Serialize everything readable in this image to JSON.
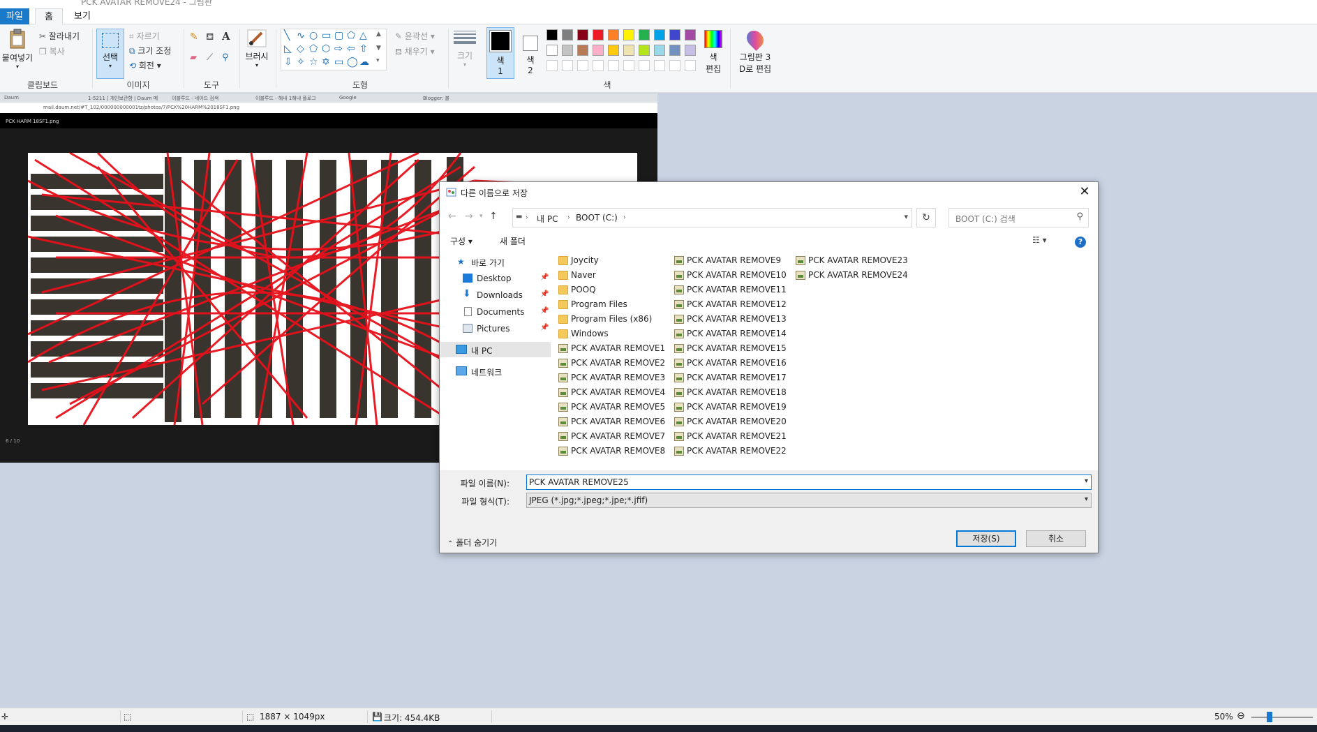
{
  "window": {
    "title": "PCK AVATAR REMOVE24 - 그림판"
  },
  "ribbon": {
    "tabs": {
      "file": "파일",
      "home": "홈",
      "view": "보기"
    },
    "clipboard": {
      "paste": "붙여넣기",
      "cut": "잘라내기",
      "copy": "복사",
      "label": "클립보드"
    },
    "image": {
      "select": "선택",
      "crop": "자르기",
      "resize": "크기 조정",
      "rotate": "회전",
      "label": "이미지"
    },
    "tools": {
      "label": "도구"
    },
    "brushes": {
      "label": "브러시"
    },
    "shapes": {
      "outline": "윤곽선",
      "fill": "채우기",
      "label": "도형"
    },
    "size": {
      "label": "크기"
    },
    "color1": {
      "line1": "색",
      "line2": "1"
    },
    "color2": {
      "line1": "색",
      "line2": "2"
    },
    "edit_colors": {
      "line1": "색",
      "line2": "편집"
    },
    "paint3d": {
      "line1": "그림판 3",
      "line2": "D로 편집"
    },
    "colors_label": "색",
    "palette_row1": [
      "#000000",
      "#7f7f7f",
      "#880015",
      "#ed1c24",
      "#ff7f27",
      "#fff200",
      "#22b14c",
      "#00a2e8",
      "#3f48cc",
      "#a349a4"
    ],
    "palette_row2": [
      "#ffffff",
      "#c3c3c3",
      "#b97a57",
      "#ffaec9",
      "#ffc90e",
      "#efe4b0",
      "#b5e61d",
      "#99d9ea",
      "#7092be",
      "#c8bfe7"
    ]
  },
  "pasted_image": {
    "tabs": [
      "Daum",
      "1-5211 | 개인보관함 | Daum 메",
      "이블루드 - 네이드 검색",
      "이블루드 - 해내 1해내 플로그",
      "Google",
      "Blogger: 블"
    ],
    "url": "mail.daum.net/#T_102/000000000001tz/photos/7/PCK%20HARM%2018SF1.png",
    "viewer_title": "PCK HARM 18SF1.png",
    "page_indicator": "6 / 10"
  },
  "dialog": {
    "title": "다른 이름으로 저장",
    "close": "✕",
    "path": [
      "내 PC",
      "BOOT (C:)"
    ],
    "search_placeholder": "BOOT (C:) 검색",
    "organize": "구성",
    "new_folder": "새 폴더",
    "nav": [
      {
        "label": "바로 가기",
        "pinned": false
      },
      {
        "label": "Desktop",
        "pinned": true
      },
      {
        "label": "Downloads",
        "pinned": true
      },
      {
        "label": "Documents",
        "pinned": true
      },
      {
        "label": "Pictures",
        "pinned": true
      },
      {
        "label": "내 PC",
        "pinned": false
      },
      {
        "label": "네트워크",
        "pinned": false
      }
    ],
    "folders": [
      "Joycity",
      "Naver",
      "POOQ",
      "Program Files",
      "Program Files (x86)",
      "Windows"
    ],
    "files_col1": [
      "PCK AVATAR REMOVE1",
      "PCK AVATAR REMOVE2",
      "PCK AVATAR REMOVE3",
      "PCK AVATAR REMOVE4",
      "PCK AVATAR REMOVE5",
      "PCK AVATAR REMOVE6",
      "PCK AVATAR REMOVE7",
      "PCK AVATAR REMOVE8"
    ],
    "files_col2": [
      "PCK AVATAR REMOVE9",
      "PCK AVATAR REMOVE10",
      "PCK AVATAR REMOVE11",
      "PCK AVATAR REMOVE12",
      "PCK AVATAR REMOVE13",
      "PCK AVATAR REMOVE14",
      "PCK AVATAR REMOVE15",
      "PCK AVATAR REMOVE16",
      "PCK AVATAR REMOVE17",
      "PCK AVATAR REMOVE18",
      "PCK AVATAR REMOVE19",
      "PCK AVATAR REMOVE20",
      "PCK AVATAR REMOVE21",
      "PCK AVATAR REMOVE22"
    ],
    "files_col3": [
      "PCK AVATAR REMOVE23",
      "PCK AVATAR REMOVE24"
    ],
    "filename_label": "파일 이름(N):",
    "filename_value": "PCK AVATAR REMOVE25",
    "filetype_label": "파일 형식(T):",
    "filetype_value": "JPEG (*.jpg;*.jpeg;*.jpe;*.jfif)",
    "hide_folders": "폴더 숨기기",
    "save": "저장(S)",
    "cancel": "취소"
  },
  "status": {
    "dimensions": "1887 × 1049px",
    "size": "크기: 454.4KB",
    "zoom": "50%",
    "zoom_level": 0.3
  }
}
